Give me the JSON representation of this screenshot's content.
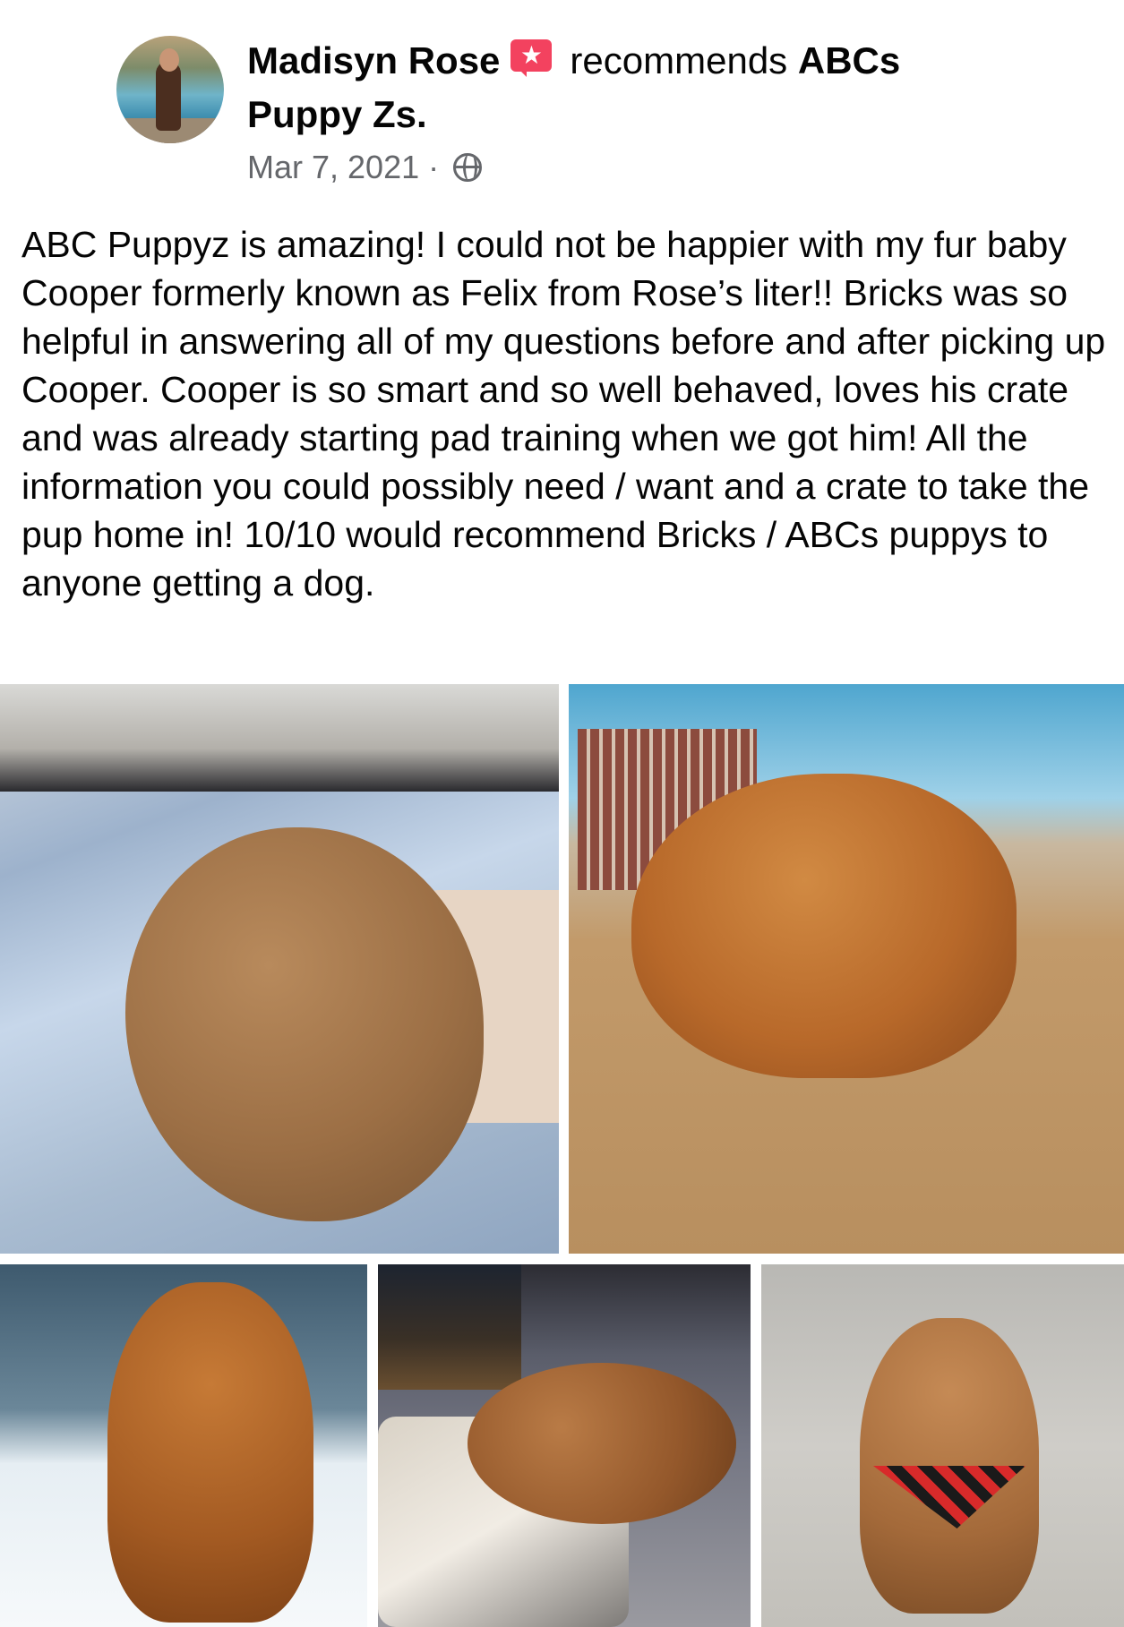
{
  "post": {
    "author": "Madisyn Rose",
    "action": "recommends",
    "page_name_part1": "ABCs",
    "page_name_part2": "Puppy Zs.",
    "date": "Mar 7, 2021",
    "separator": "·",
    "privacy_icon": "globe-icon",
    "recommend_icon": "recommend-star-icon",
    "recommend_color": "#f3425f",
    "text": "ABC Puppyz is amazing!  I could not be happier with my fur baby Cooper formerly known as Felix from Rose’s liter!! Bricks was so helpful in answering all of my questions before and after picking up Cooper. Cooper is so smart and so well behaved, loves his crate and was already starting pad training when we got him! All the information you could possibly need / want and a crate to take the pup home in! 10/10 would recommend Bricks / ABCs puppys to anyone getting a dog.",
    "photo_count": 5
  }
}
